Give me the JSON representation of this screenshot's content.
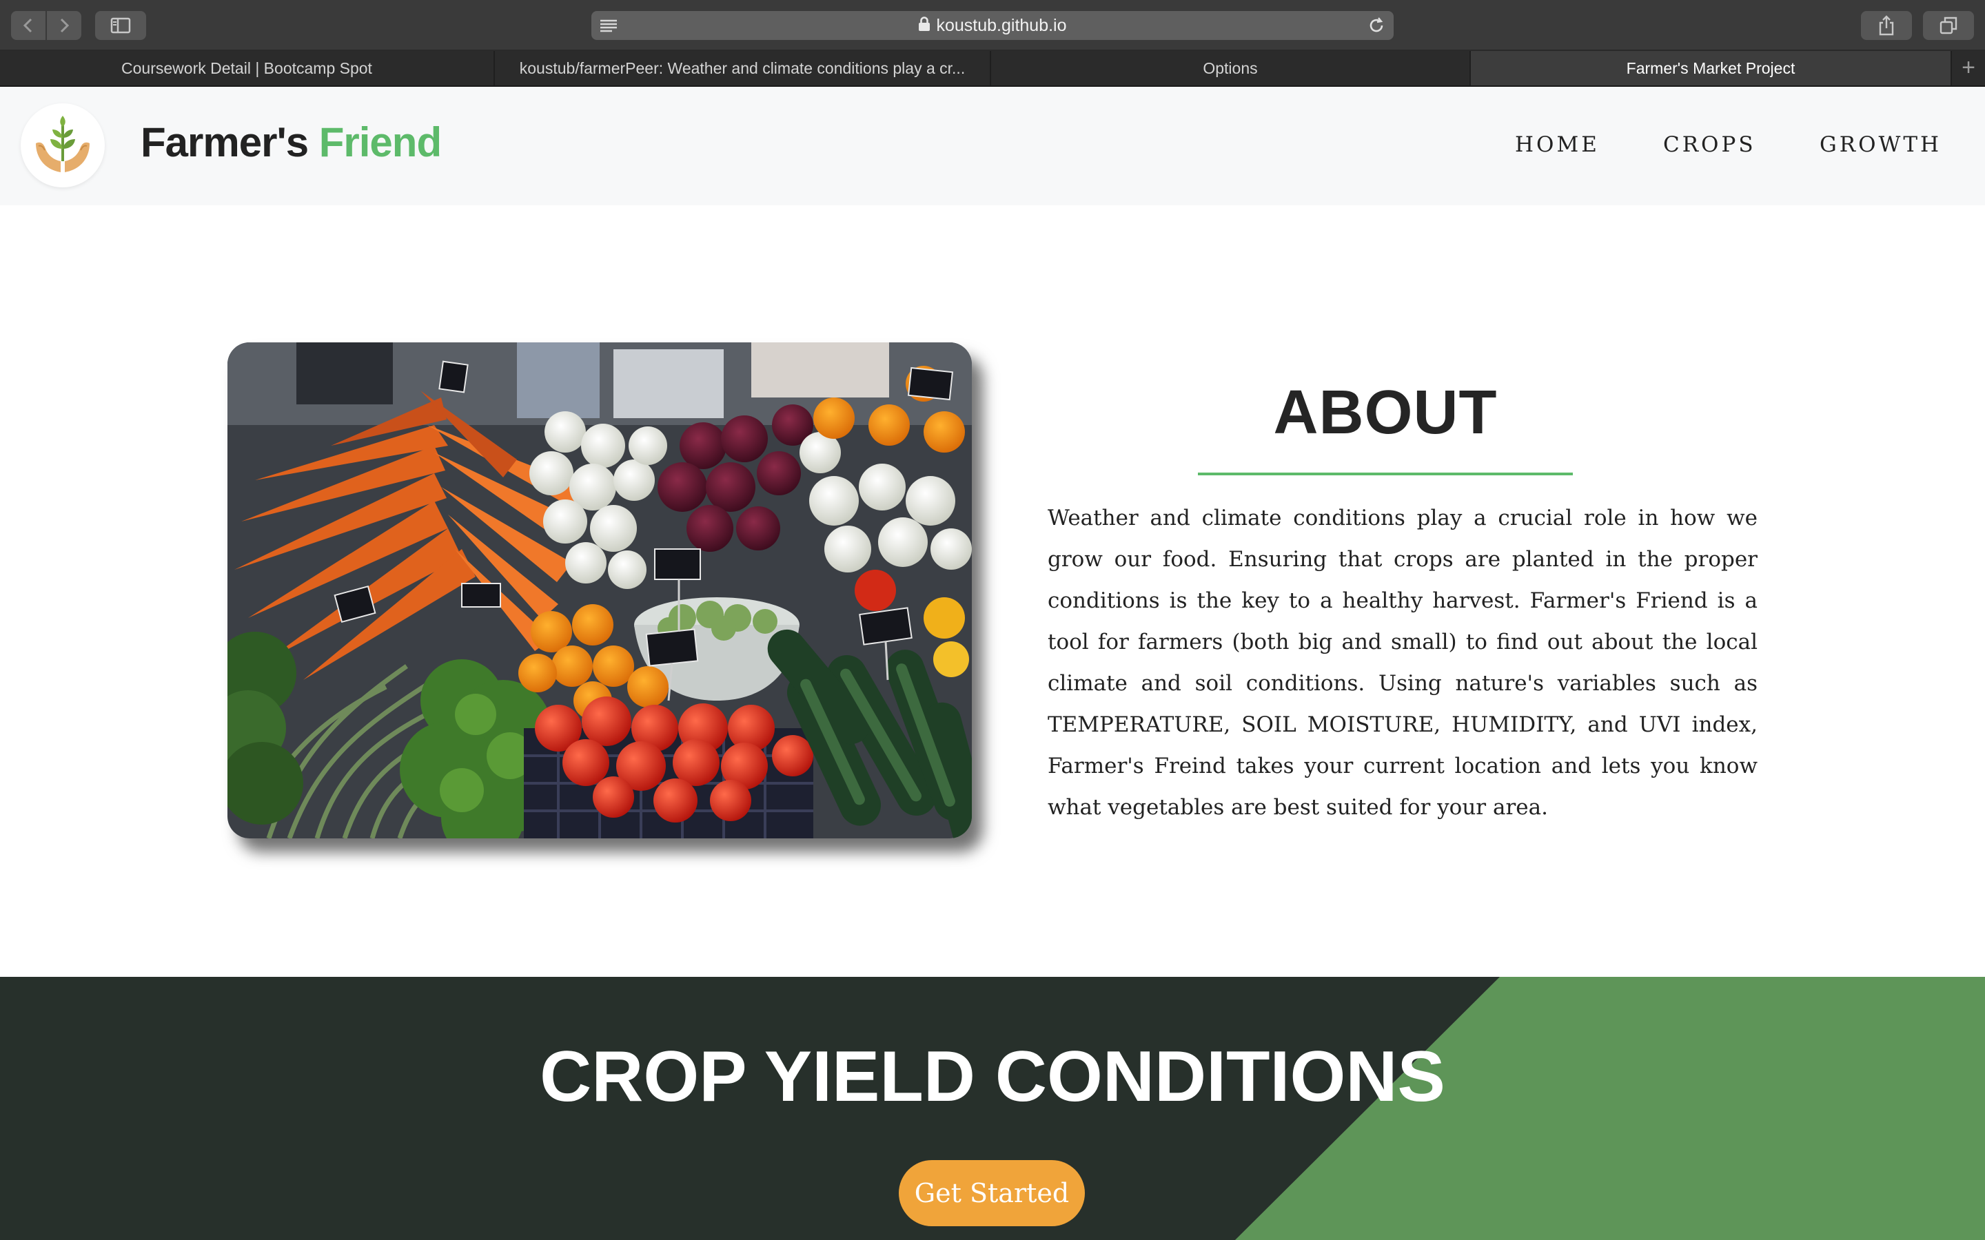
{
  "browser": {
    "url": "koustub.github.io",
    "tabs": [
      {
        "label": "Coursework Detail | Bootcamp Spot",
        "active": false
      },
      {
        "label": "koustub/farmerPeer: Weather and climate conditions play a cr...",
        "active": false
      },
      {
        "label": "Options",
        "active": false
      },
      {
        "label": "Farmer's Market Project",
        "active": true
      }
    ],
    "new_tab_label": "+"
  },
  "header": {
    "brand_primary": "Farmer's",
    "brand_accent": "Friend",
    "nav": [
      {
        "label": "HOME"
      },
      {
        "label": "CROPS"
      },
      {
        "label": "GROWTH"
      }
    ]
  },
  "about": {
    "title": "ABOUT",
    "body": "Weather and climate conditions play a crucial role in how we grow our food. Ensuring that crops are planted in the proper conditions is the key to a healthy harvest. Farmer's Friend is a tool for farmers (both big and small) to find out about the local climate and soil conditions. Using nature's variables such as TEMPERATURE, SOIL MOISTURE, HUMIDITY, and UVI index, Farmer's Freind takes your current location and lets you know what vegetables are best suited for your area."
  },
  "crop_section": {
    "title": "CROP YIELD CONDITIONS",
    "button_label": "Get Started"
  },
  "colors": {
    "accent_green": "#5dba6a",
    "dark_band": "#27302b",
    "band_green": "#5e9558",
    "button_orange": "#f0a43a"
  },
  "icons": [
    "back-icon",
    "forward-icon",
    "sidebar-icon",
    "reader-icon",
    "lock-icon",
    "reload-icon",
    "share-icon",
    "tabs-overview-icon",
    "plant-hands-logo-icon"
  ]
}
